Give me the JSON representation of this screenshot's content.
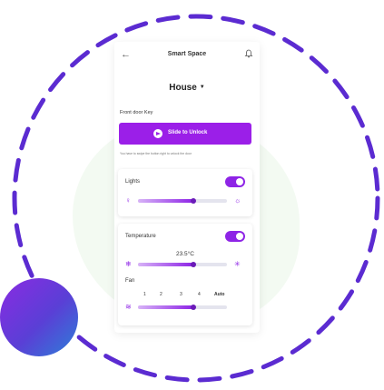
{
  "header": {
    "title": "Smart Space",
    "back_icon": "back-arrow-icon",
    "bell_icon": "bell-icon"
  },
  "location": {
    "selected": "House"
  },
  "front_door": {
    "label": "Front door Key",
    "button_label": "Slide to Unlock",
    "hint": "You have to swipe the button right to unlock the door"
  },
  "lights": {
    "label": "Lights",
    "enabled": true,
    "level_percent": 62,
    "icons": [
      "bulb-off-icon",
      "bulb-on-icon"
    ]
  },
  "temperature": {
    "label": "Temperature",
    "enabled": true,
    "value": "23.5°C",
    "level_percent": 62,
    "icons": [
      "snowflake-icon",
      "sun-icon"
    ]
  },
  "fan": {
    "label": "Fan",
    "ticks": [
      "1",
      "2",
      "3",
      "4",
      "Auto"
    ],
    "level_percent": 62,
    "icon": "wind-icon"
  },
  "colors": {
    "accent": "#9b1fe8",
    "ring": "#5b2bd1",
    "background_blob": "#eef8ec"
  }
}
